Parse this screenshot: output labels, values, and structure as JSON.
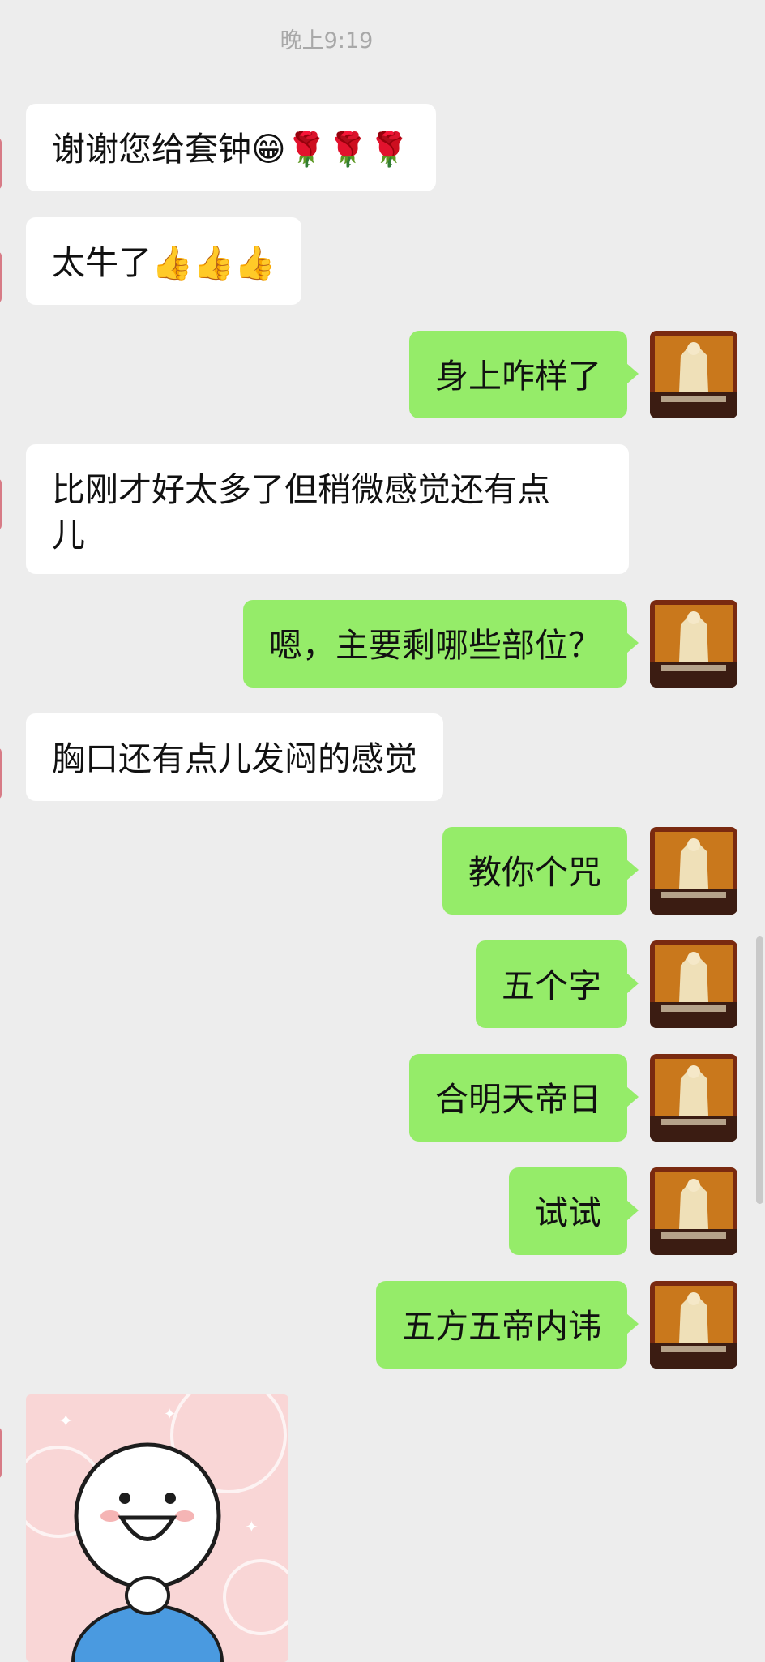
{
  "timestamp": "晚上9:19",
  "messages": [
    {
      "side": "in",
      "text": "谢谢您给套钟😁🌹🌹🌹"
    },
    {
      "side": "in",
      "text": "太牛了👍👍👍"
    },
    {
      "side": "out",
      "text": "身上咋样了"
    },
    {
      "side": "in",
      "text": "比刚才好太多了但稍微感觉还有点\n儿"
    },
    {
      "side": "out",
      "text": "嗯，主要剩哪些部位？"
    },
    {
      "side": "in",
      "text": "胸口还有点儿发闷的感觉"
    },
    {
      "side": "out",
      "text": "教你个咒"
    },
    {
      "side": "out",
      "text": "五个字"
    },
    {
      "side": "out",
      "text": "合明天帝日"
    },
    {
      "side": "out",
      "text": "试试"
    },
    {
      "side": "out",
      "text": "五方五帝内讳"
    }
  ],
  "colors": {
    "background": "#ededed",
    "bubble_in": "#ffffff",
    "bubble_out": "#95ec69",
    "timestamp": "#a8a8a8"
  },
  "icons": {
    "sender_avatar": "temple-statue-avatar",
    "sticker": "smiling-cartoon-sticker"
  }
}
